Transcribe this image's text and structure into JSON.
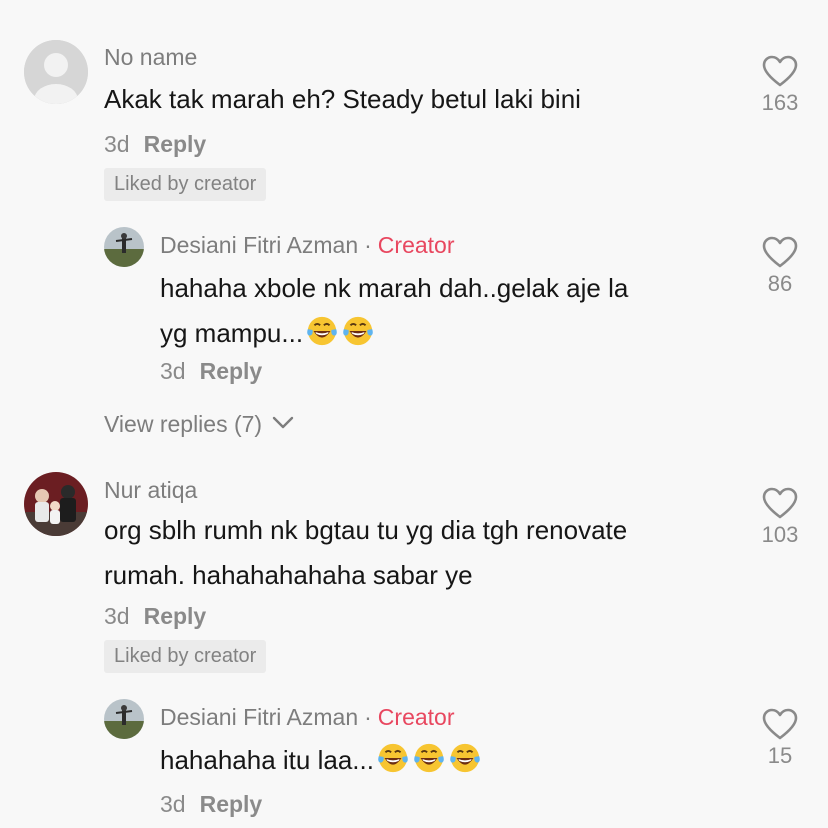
{
  "comments": [
    {
      "name": "No name",
      "text": "Akak tak marah eh? Steady betul laki bini",
      "time": "3d",
      "reply": "Reply",
      "liked": "Liked by creator",
      "likes": "163",
      "avatar": "default-avatar"
    },
    {
      "name": "Desiani Fitri Azman",
      "badge_sep": "·",
      "badge": "Creator",
      "text_line1": "hahaha xbole nk marah dah..gelak aje la",
      "text_line2": "yg mampu...",
      "emoji_count": 2,
      "time": "3d",
      "reply": "Reply",
      "likes": "86",
      "avatar": "creator-avatar"
    },
    {
      "view_replies": "View replies (7)"
    },
    {
      "name": "Nur atiqa",
      "text_line1": "org sblh rumh nk bgtau tu yg dia tgh renovate",
      "text_line2": "rumah. hahahahahaha sabar ye",
      "time": "3d",
      "reply": "Reply",
      "liked": "Liked by creator",
      "likes": "103",
      "avatar": "family-photo-avatar"
    },
    {
      "name": "Desiani Fitri Azman",
      "badge_sep": "·",
      "badge": "Creator",
      "text": "hahahaha itu laa...",
      "emoji_count": 3,
      "time": "3d",
      "reply": "Reply",
      "likes": "15",
      "avatar": "creator-avatar"
    }
  ],
  "emoji_name": "face-with-tears-of-joy",
  "colors": {
    "background": "#f8f8f8",
    "creator_badge": "#e8475f",
    "text": "#161616",
    "secondary": "#8a8a8a"
  }
}
